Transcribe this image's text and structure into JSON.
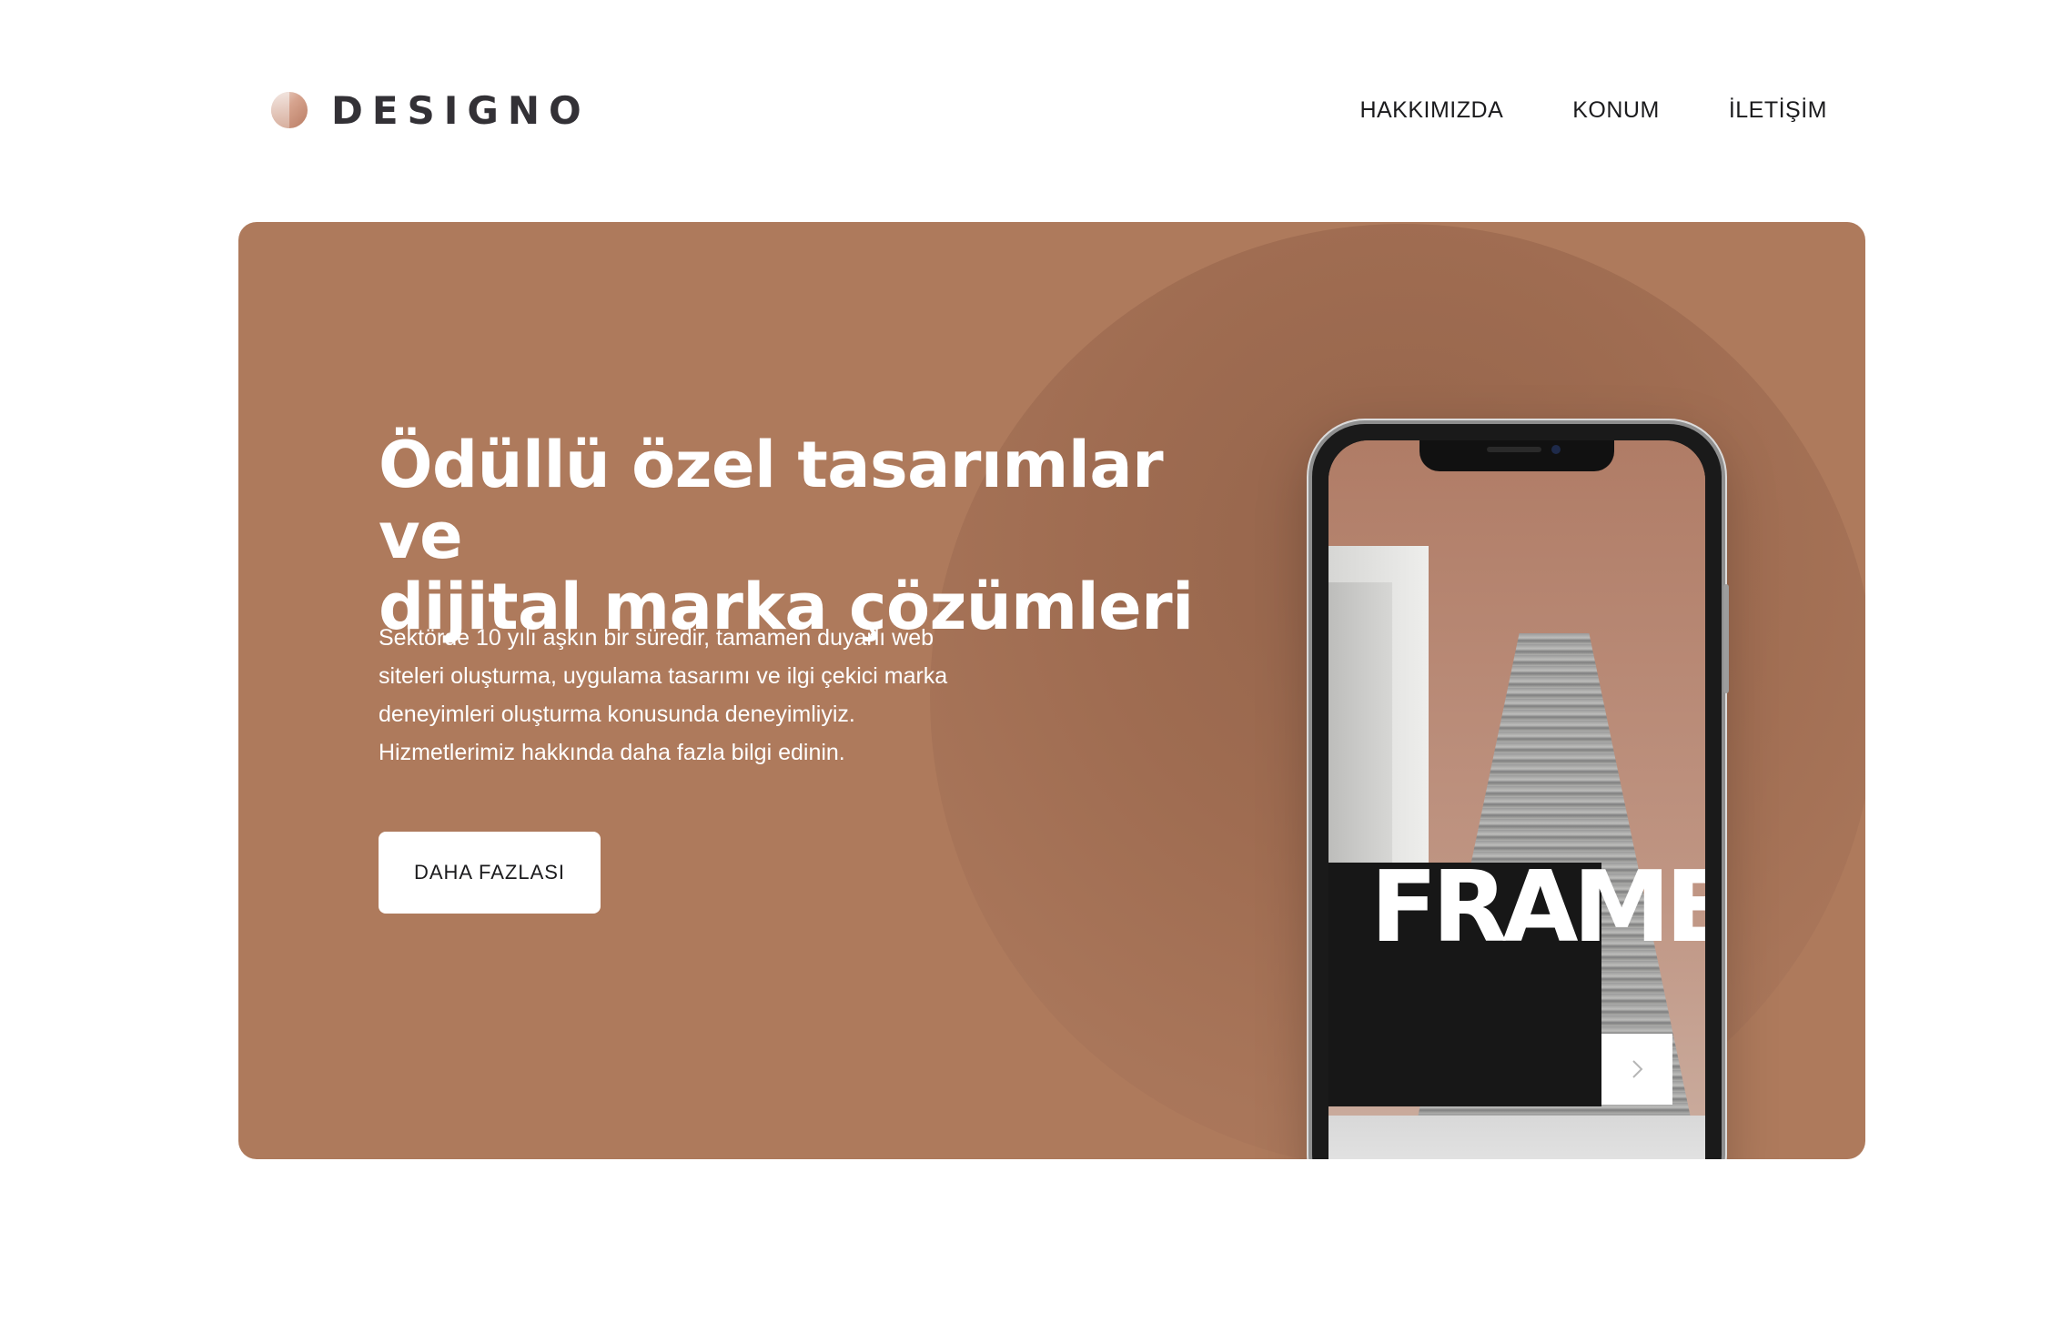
{
  "header": {
    "logo_text": "DESIGNO",
    "nav": [
      {
        "label": "HAKKIMIZDA"
      },
      {
        "label": "KONUM"
      },
      {
        "label": "İLETİŞİM"
      }
    ]
  },
  "hero": {
    "title_line1": "Ödüllü özel tasarımlar ve",
    "title_line2": "dijital marka çözümleri",
    "description": "Sektörde 10 yılı aşkın bir süredir, tamamen duyarlı web siteleri oluşturma, uygulama tasarımı ve ilgi çekici marka deneyimleri oluşturma konusunda deneyimliyiz. Hizmetlerimiz hakkında daha fazla bilgi edinin.",
    "button_label": "DAHA FAZLASI",
    "phone_screen_text": "FRAME"
  },
  "colors": {
    "hero_background": "#ae7a5c",
    "circle": "#9f6c51",
    "text_dark": "#333136",
    "white": "#ffffff"
  },
  "icons": {
    "logo": "half-circle-logo-icon",
    "next": "chevron-right-icon"
  }
}
